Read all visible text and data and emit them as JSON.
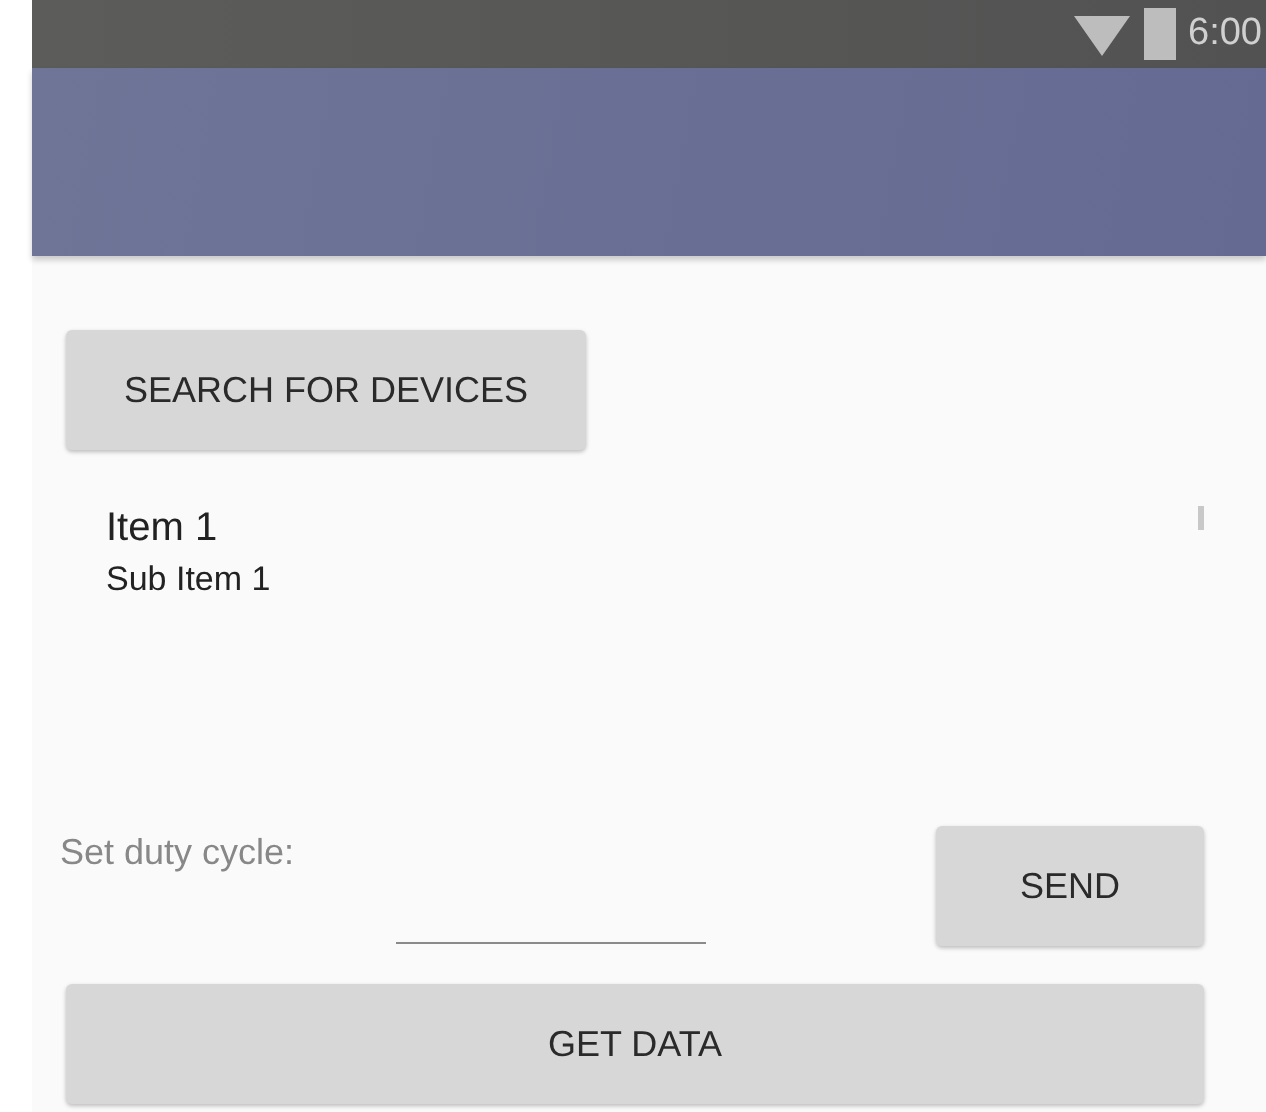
{
  "status_bar": {
    "time": "6:00"
  },
  "search_button": "SEARCH FOR DEVICES",
  "list": [
    {
      "title": "Item 1",
      "subtitle": "Sub Item 1"
    }
  ],
  "duty_cycle": {
    "label": "Set duty cycle:"
  },
  "send_button": "SEND",
  "get_data_button": "GET DATA"
}
